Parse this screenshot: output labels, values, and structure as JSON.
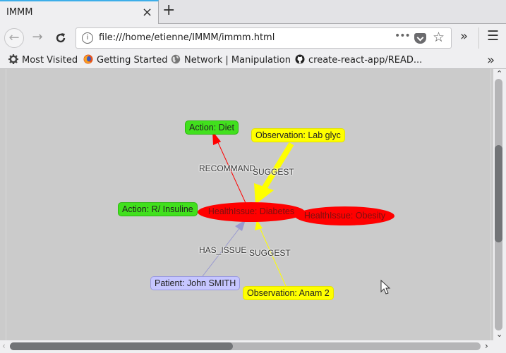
{
  "browser": {
    "tab_title": "IMMM",
    "tab_close_icon": "×",
    "new_tab_icon": "+",
    "url": "file:///home/etienne/IMMM/immm.html",
    "url_info_icon": "i",
    "page_actions_icon": "•••",
    "bookmark_star_icon": "☆",
    "overflow_icon": "»",
    "menu_icon": "☰",
    "back_icon": "←",
    "forward_icon": "→",
    "reload_icon": "C"
  },
  "bookmarks": [
    {
      "label": "Most Visited",
      "icon": "gear-icon"
    },
    {
      "label": "Getting Started",
      "icon": "firefox-icon"
    },
    {
      "label": "Network | Manipulation",
      "icon": "globe-icon"
    },
    {
      "label": "create-react-app/READ...",
      "icon": "github-icon"
    }
  ],
  "bookmarks_overflow_icon": "»",
  "graph": {
    "nodes": [
      {
        "id": "action-diet",
        "label": "Action: Diet",
        "type": "Action",
        "color": "#41e01d"
      },
      {
        "id": "obs-lab-glyc",
        "label": "Observation: Lab glyc",
        "type": "Observation",
        "color": "#ffff00"
      },
      {
        "id": "action-insuline",
        "label": "Action: R/ Insuline",
        "type": "Action",
        "color": "#41e01d"
      },
      {
        "id": "issue-diabetes",
        "label": "HealthIssue: Diabetes",
        "type": "HealthIssue",
        "color": "#ff0000"
      },
      {
        "id": "issue-obesity",
        "label": "HealthIssue: Obesity",
        "type": "HealthIssue",
        "color": "#ff0000"
      },
      {
        "id": "patient-john",
        "label": "Patient: John SMITH",
        "type": "Patient",
        "color": "#c6c6ff"
      },
      {
        "id": "obs-anam2",
        "label": "Observation: Anam 2",
        "type": "Observation",
        "color": "#ffff00"
      }
    ],
    "edges": [
      {
        "from": "issue-diabetes",
        "to": "action-diet",
        "label": "RECOMMAND",
        "color": "#ff0000"
      },
      {
        "from": "obs-lab-glyc",
        "to": "issue-diabetes",
        "label": "SUGGEST",
        "color": "#ffff00"
      },
      {
        "from": "patient-john",
        "to": "issue-diabetes",
        "label": "HAS_ISSUE",
        "color": "#9a9ad0"
      },
      {
        "from": "obs-anam2",
        "to": "issue-diabetes",
        "label": "SUGGEST",
        "color": "#ffff00"
      },
      {
        "from": "issue-diabetes",
        "to": "action-insuline",
        "label": "RECOMMAND",
        "color": "#ff0000"
      }
    ]
  },
  "scrollbars": {
    "up_icon": "⌃",
    "down_icon": "⌄",
    "left_icon": "‹",
    "right_icon": "›"
  }
}
